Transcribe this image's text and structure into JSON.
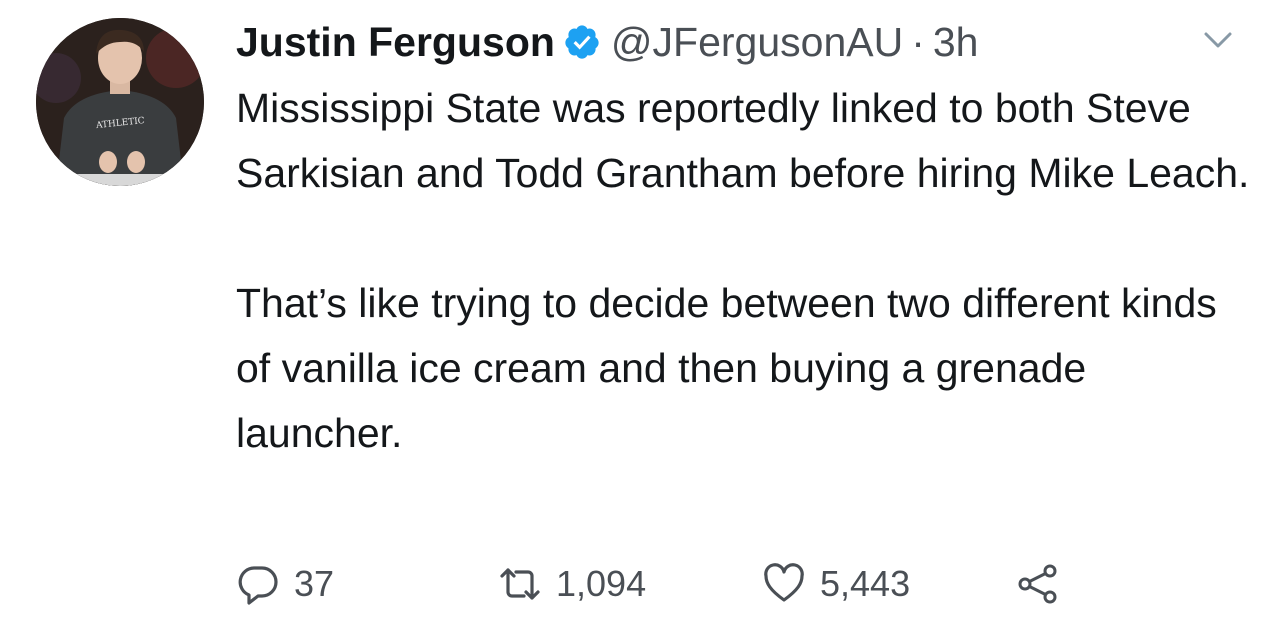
{
  "tweet": {
    "author_name": "Justin Ferguson",
    "handle": "@JFergusonAU",
    "separator": "·",
    "time": "3h",
    "paragraph_1": "Mississippi State was reportedly linked to both Steve Sarkisian and Todd Grantham before hiring Mike Leach.",
    "paragraph_2": "That’s like trying to decide between two different kinds of vanilla ice cream and then buying a grenade launcher.",
    "avatar_shirt_text": "ATHLETIC"
  },
  "actions": {
    "reply_count": "37",
    "retweet_count": "1,094",
    "like_count": "5,443"
  },
  "icons": {
    "verified": "verified-badge-icon",
    "caret": "chevron-down-icon",
    "reply": "reply-icon",
    "retweet": "retweet-icon",
    "like": "heart-icon",
    "share": "share-icon"
  },
  "colors": {
    "text": "#14171a",
    "secondary": "#4a4f55",
    "verified": "#1da1f2"
  }
}
